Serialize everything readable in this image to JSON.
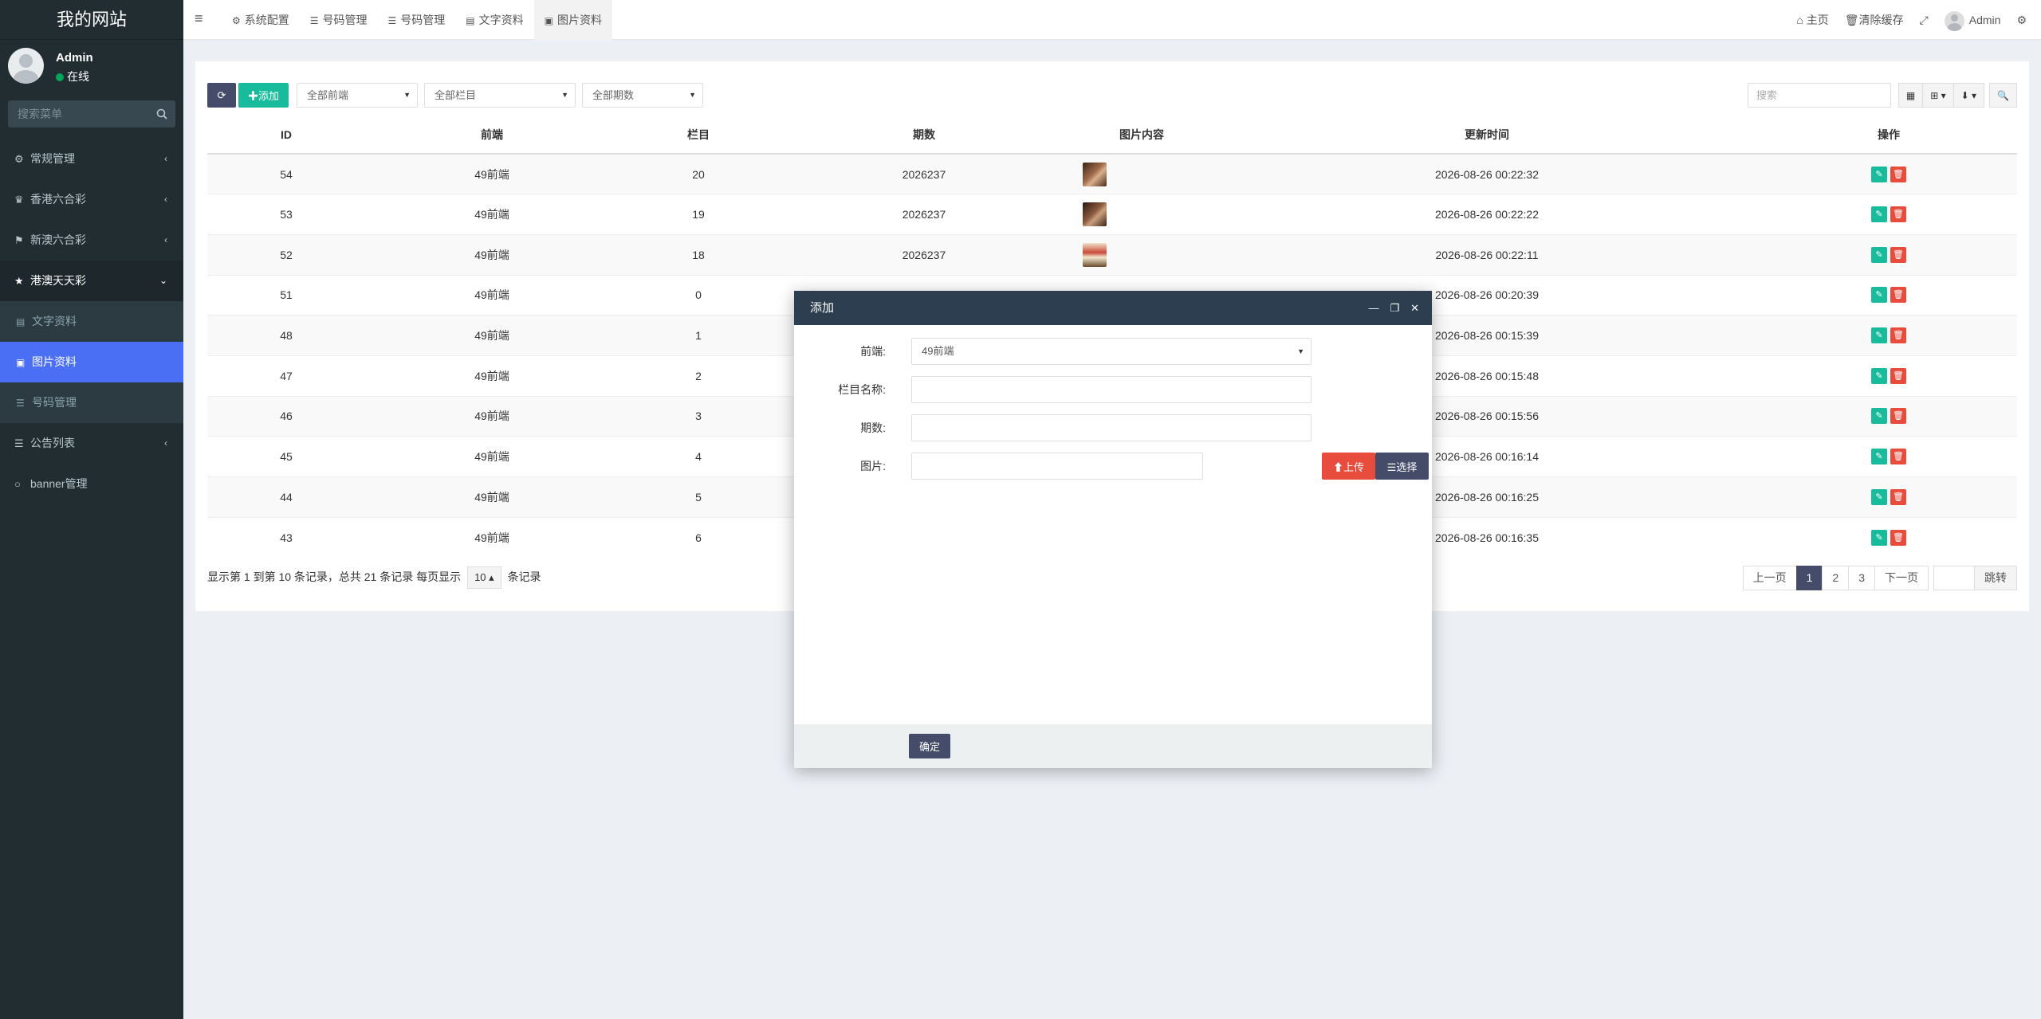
{
  "sidebar": {
    "logo": "我的网站",
    "user": {
      "name": "Admin",
      "status": "在线"
    },
    "search_placeholder": "搜索菜单",
    "menu": [
      {
        "label": "常规管理",
        "icon": "cogs-icon"
      },
      {
        "label": "香港六合彩",
        "icon": "trophy-icon"
      },
      {
        "label": "新澳六合彩",
        "icon": "flag-icon"
      },
      {
        "label": "港澳天天彩",
        "icon": "star-icon"
      },
      {
        "label": "公告列表",
        "icon": "list-icon"
      },
      {
        "label": "banner管理",
        "icon": "circle-icon"
      }
    ],
    "submenu": [
      {
        "label": "文字资料",
        "icon": "database-icon"
      },
      {
        "label": "图片资料",
        "icon": "image-icon"
      },
      {
        "label": "号码管理",
        "icon": "list-icon"
      }
    ]
  },
  "topbar": {
    "tabs": [
      {
        "label": "系统配置",
        "icon": "gear-icon"
      },
      {
        "label": "号码管理",
        "icon": "list-icon"
      },
      {
        "label": "号码管理",
        "icon": "list-icon"
      },
      {
        "label": "文字资料",
        "icon": "database-icon"
      },
      {
        "label": "图片资料",
        "icon": "image-icon"
      }
    ],
    "home": "主页",
    "clear_cache": "清除缓存",
    "admin": "Admin"
  },
  "toolbar": {
    "add_label": "添加",
    "filter_frontend": "全部前端",
    "filter_column": "全部栏目",
    "filter_period": "全部期数",
    "search_placeholder": "搜索"
  },
  "table": {
    "columns": [
      "ID",
      "前端",
      "栏目",
      "期数",
      "图片内容",
      "更新时间",
      "操作"
    ],
    "rows": [
      {
        "id": "54",
        "frontend": "49前端",
        "column": "20",
        "period": "2026237",
        "time": "2026-08-26 00:22:32"
      },
      {
        "id": "53",
        "frontend": "49前端",
        "column": "19",
        "period": "2026237",
        "time": "2026-08-26 00:22:22"
      },
      {
        "id": "52",
        "frontend": "49前端",
        "column": "18",
        "period": "2026237",
        "time": "2026-08-26 00:22:11"
      },
      {
        "id": "51",
        "frontend": "49前端",
        "column": "0",
        "period": "",
        "time": "2026-08-26 00:20:39"
      },
      {
        "id": "48",
        "frontend": "49前端",
        "column": "1",
        "period": "",
        "time": "2026-08-26 00:15:39"
      },
      {
        "id": "47",
        "frontend": "49前端",
        "column": "2",
        "period": "",
        "time": "2026-08-26 00:15:48"
      },
      {
        "id": "46",
        "frontend": "49前端",
        "column": "3",
        "period": "",
        "time": "2026-08-26 00:15:56"
      },
      {
        "id": "45",
        "frontend": "49前端",
        "column": "4",
        "period": "",
        "time": "2026-08-26 00:16:14"
      },
      {
        "id": "44",
        "frontend": "49前端",
        "column": "5",
        "period": "",
        "time": "2026-08-26 00:16:25"
      },
      {
        "id": "43",
        "frontend": "49前端",
        "column": "6",
        "period": "",
        "time": "2026-08-26 00:16:35"
      }
    ]
  },
  "pagination": {
    "info_prefix": "显示第 1 到第 10 条记录，总共 21 条记录 每页显示",
    "per_page": "10",
    "info_suffix": "条记录",
    "prev": "上一页",
    "pages": [
      "1",
      "2",
      "3"
    ],
    "next": "下一页",
    "jump": "跳转"
  },
  "modal": {
    "title": "添加",
    "fields": {
      "frontend_label": "前端:",
      "frontend_value": "49前端",
      "column_label": "栏目名称:",
      "period_label": "期数:",
      "image_label": "图片:"
    },
    "upload": "上传",
    "choose": "选择",
    "confirm": "确定"
  },
  "colors": {
    "sidebar_bg": "#222d32",
    "active_menu": "#4a6ff5",
    "primary": "#444c69",
    "success": "#18bc9c",
    "danger": "#e74c3c",
    "modal_header": "#2c3e50"
  }
}
